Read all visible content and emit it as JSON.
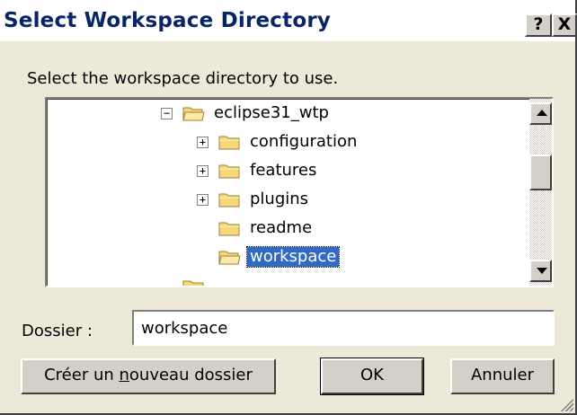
{
  "window": {
    "title": "Select Workspace Directory",
    "help_label": "?",
    "close_label": "X"
  },
  "prompt": "Select the workspace directory to use.",
  "tree": {
    "nodes": [
      {
        "label": "eclipse31_wtp",
        "expander": "−",
        "selected": false
      },
      {
        "label": "configuration",
        "expander": "+",
        "selected": false
      },
      {
        "label": "features",
        "expander": "+",
        "selected": false
      },
      {
        "label": "plugins",
        "expander": "+",
        "selected": false
      },
      {
        "label": "readme",
        "expander": "",
        "selected": false
      },
      {
        "label": "workspace",
        "expander": "",
        "selected": true
      }
    ]
  },
  "folder_field": {
    "label": "Dossier :",
    "value": "workspace"
  },
  "buttons": {
    "new_folder_pre": "Créer un ",
    "new_folder_mnemonic": "n",
    "new_folder_post": "ouveau dossier",
    "ok": "OK",
    "cancel": "Annuler"
  },
  "colors": {
    "title_text": "#0a246a",
    "selection": "#316ac5",
    "dialog_bg": "#ece9d8"
  }
}
